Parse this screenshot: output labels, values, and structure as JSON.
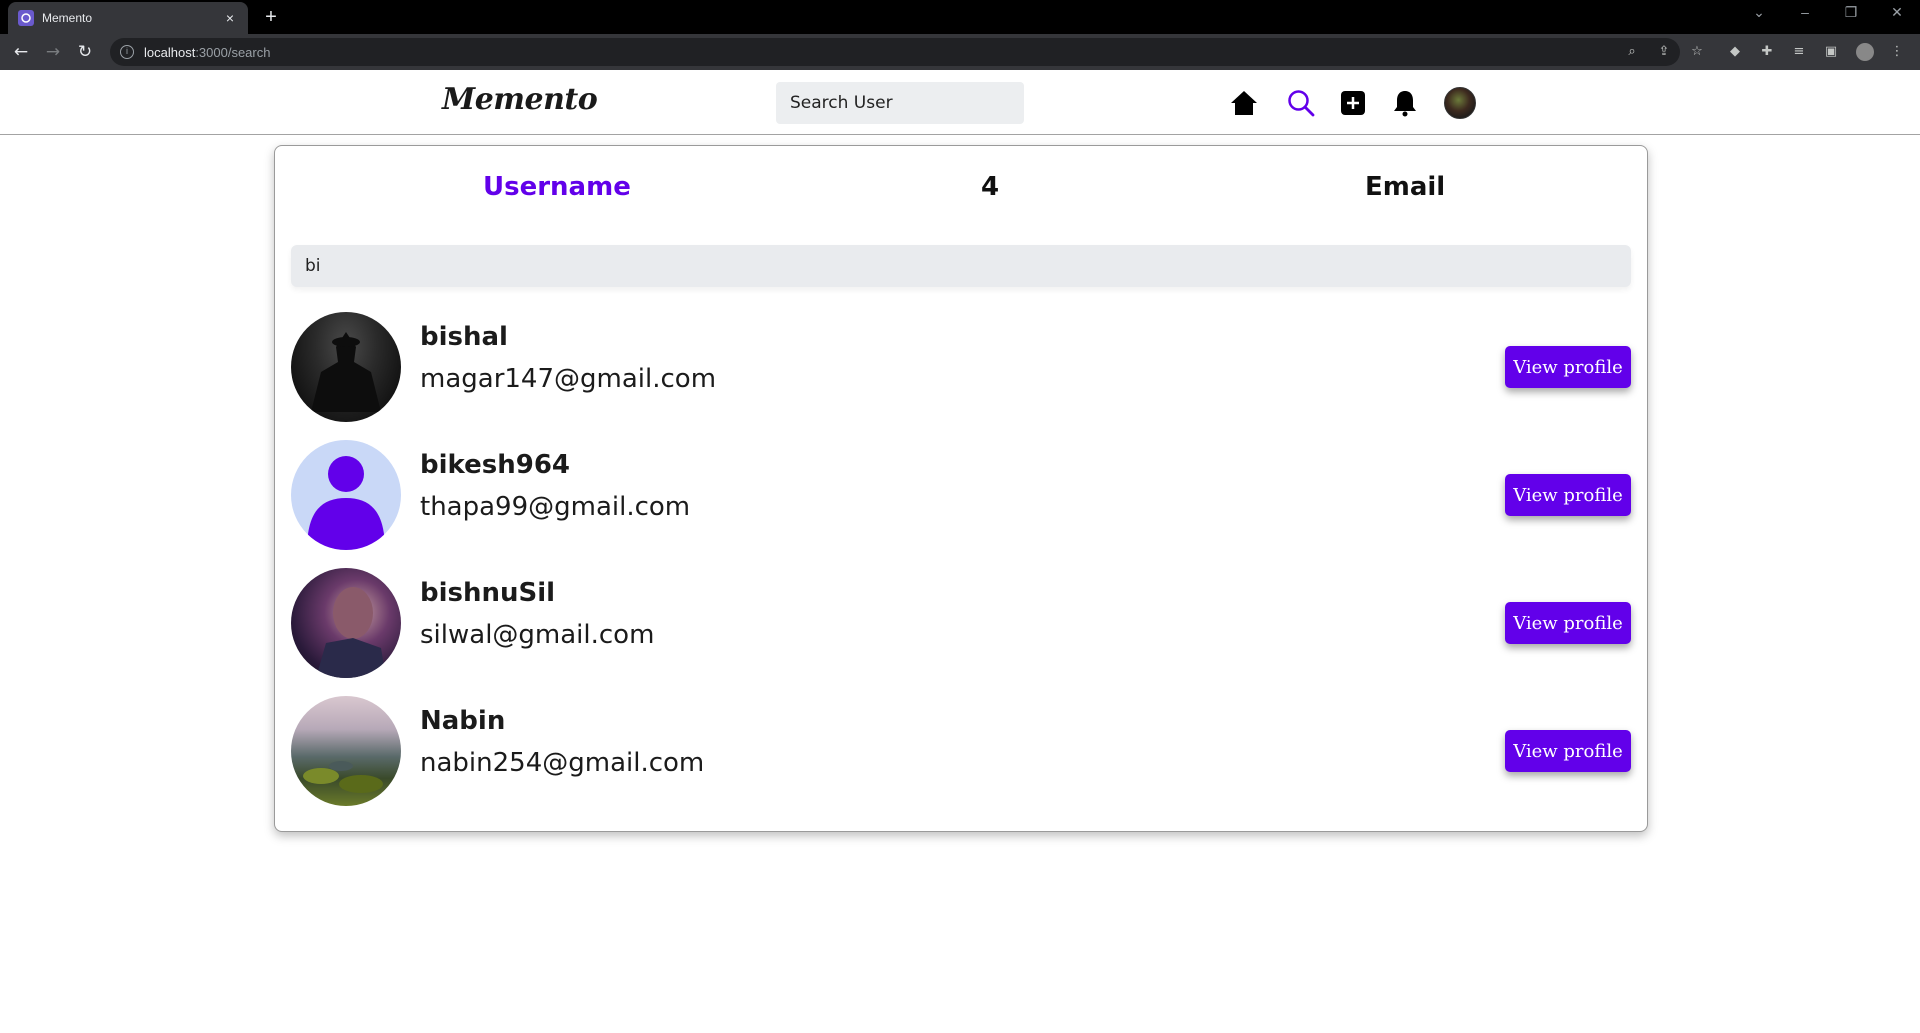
{
  "browser": {
    "tab_title": "Memento",
    "tab_close": "×",
    "new_tab": "+",
    "url_host": "localhost",
    "url_path": ":3000/search"
  },
  "header": {
    "logo": "Memento",
    "search_placeholder": "Search User"
  },
  "card": {
    "tabs": {
      "username": "Username",
      "count": "4",
      "email": "Email"
    },
    "filter_value": "bi",
    "results": [
      {
        "username": "bishal",
        "email": "magar147@gmail.com",
        "button": "View profile"
      },
      {
        "username": "bikesh964",
        "email": "thapa99@gmail.com",
        "button": "View profile"
      },
      {
        "username": "bishnuSil",
        "email": "silwal@gmail.com",
        "button": "View profile"
      },
      {
        "username": "Nabin",
        "email": "nabin254@gmail.com",
        "button": "View profile"
      }
    ]
  },
  "colors": {
    "accent": "#6200ea",
    "header_search_bg": "#eceef0"
  }
}
